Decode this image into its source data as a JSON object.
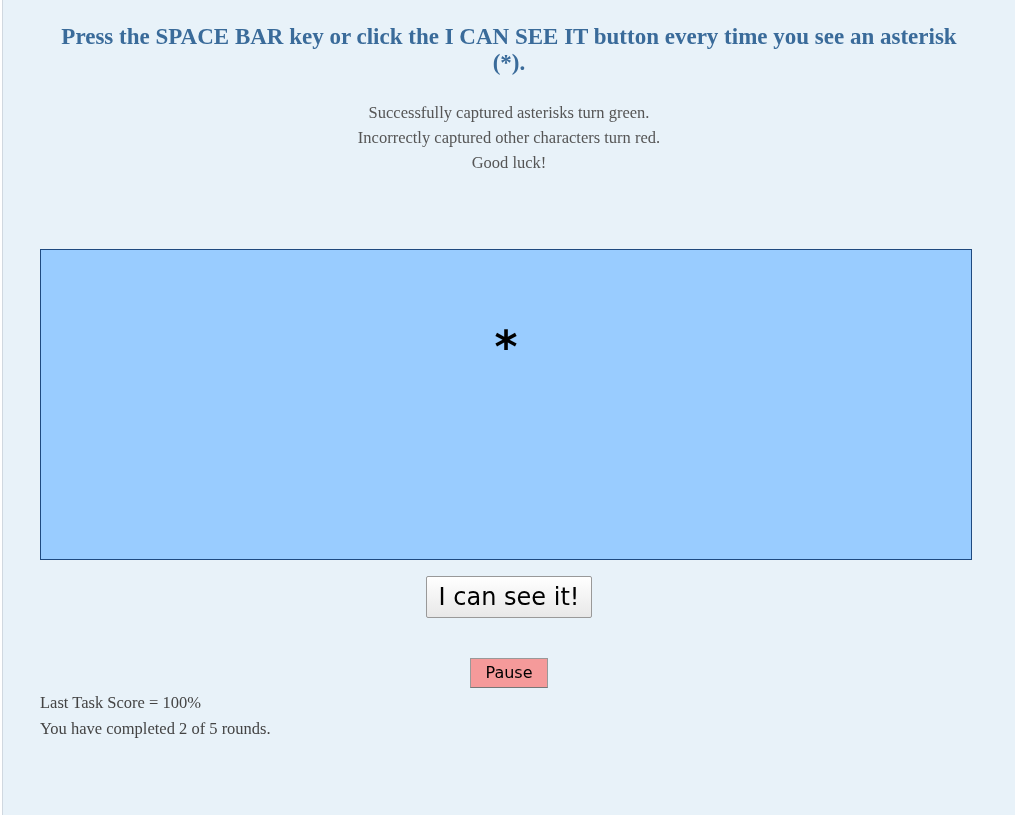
{
  "title": "Press the SPACE BAR key or click the I CAN SEE IT button every time you see an asterisk (*).",
  "instructions": [
    "Successfully captured asterisks turn green.",
    "Incorrectly captured other characters turn red.",
    "Good luck!"
  ],
  "stimulus": {
    "character": "*"
  },
  "see_button": {
    "label": "I can see it!"
  },
  "pause_button": {
    "label": "Pause"
  },
  "status": [
    "Last Task Score = 100%",
    "You have completed 2 of 5 rounds."
  ]
}
